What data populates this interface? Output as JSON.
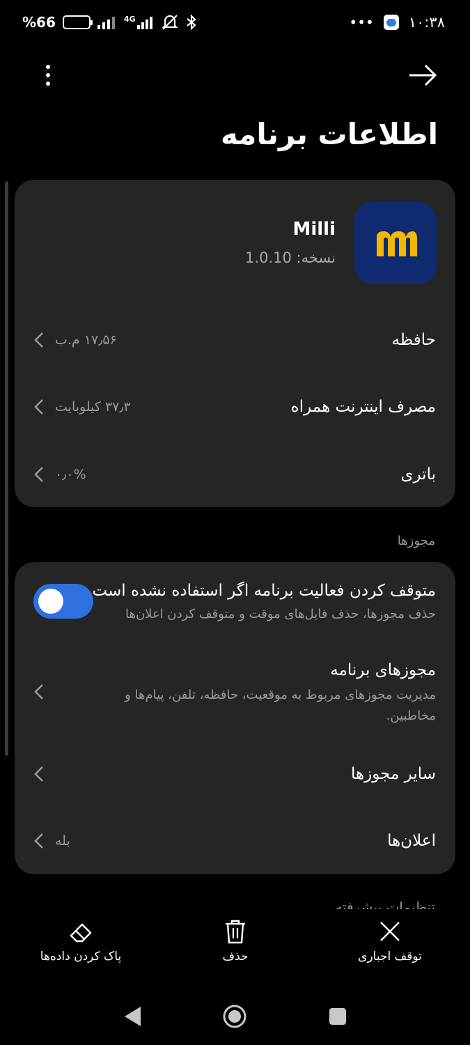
{
  "status_bar": {
    "battery_text": "%66",
    "network_type": "4G",
    "time": "۱۰:۳۸",
    "more_dots": "•••",
    "colors": {
      "battery_fill": "#f5a623"
    }
  },
  "header": {
    "title": "اطلاعات برنامه",
    "menu_icon": "more-vert-icon",
    "back_icon": "arrow-right-icon"
  },
  "app": {
    "name": "Milli",
    "version": "نسخه: 1.0.10",
    "icon_bg": "#0f2a6e",
    "icon_fg": "#f5b800"
  },
  "info_rows": [
    {
      "label": "حافظه",
      "value": "۱۷٫۵۶ م.ب"
    },
    {
      "label": "مصرف اینترنت همراه",
      "value": "۳۷٫۳ کیلوبایت"
    },
    {
      "label": "باتری",
      "value": "۰٫۰%"
    }
  ],
  "permissions": {
    "section_title": "مجوزها",
    "pause_item": {
      "title": "متوقف کردن فعالیت برنامه اگر استفاده نشده است",
      "subtitle": "حذف مجوزها، حذف فایل‌های موقت و متوقف کردن اعلان‌ها",
      "enabled": true,
      "accent": "#2f6fde"
    },
    "app_permissions": {
      "title": "مجوزهای برنامه",
      "subtitle": "مدیریت مجوزهای مربوط به موقعیت، حافظه، تلفن، پیام‌ها و مخاطبین."
    },
    "other_permissions": {
      "title": "سایر مجوزها"
    },
    "notifications": {
      "title": "اعلان‌ها",
      "value": "بله"
    }
  },
  "advanced_section_title": "تنظیمات پیشرفته",
  "actions": {
    "clear_data": {
      "label": "پاک کردن داده‌ها",
      "icon": "eraser-icon"
    },
    "delete": {
      "label": "حذف",
      "icon": "trash-icon"
    },
    "force_stop": {
      "label": "توقف اجباری",
      "icon": "close-icon"
    }
  },
  "nav": {
    "back_icon": "nav-back-icon",
    "home_icon": "nav-home-icon",
    "recents_icon": "nav-recents-icon"
  }
}
